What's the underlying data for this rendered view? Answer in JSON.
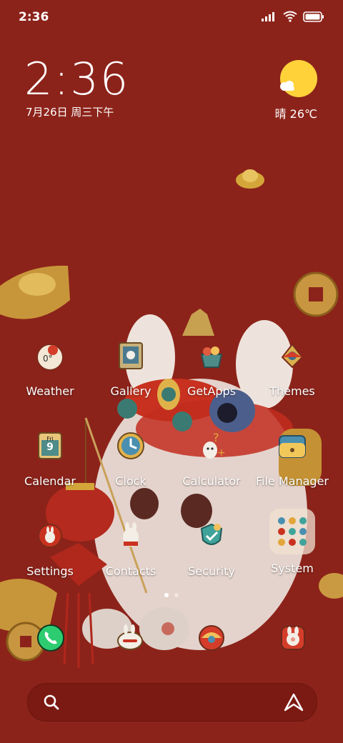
{
  "status_bar": {
    "time": "2:36"
  },
  "clock_widget": {
    "time": "2:36",
    "date": "7月26日 周三下午"
  },
  "weather_widget": {
    "condition_temp": "晴 26℃"
  },
  "apps": [
    {
      "label": "Weather",
      "icon": "weather-icon"
    },
    {
      "label": "Gallery",
      "icon": "gallery-icon"
    },
    {
      "label": "GetApps",
      "icon": "getapps-icon"
    },
    {
      "label": "Themes",
      "icon": "themes-icon"
    },
    {
      "label": "Calendar",
      "icon": "calendar-icon",
      "badge_top": "Fri",
      "badge_num": "9"
    },
    {
      "label": "Clock",
      "icon": "clock-icon"
    },
    {
      "label": "Calculator",
      "icon": "calculator-icon"
    },
    {
      "label": "File Manager",
      "icon": "folder-icon"
    },
    {
      "label": "Settings",
      "icon": "settings-icon"
    },
    {
      "label": "Contacts",
      "icon": "contacts-icon"
    },
    {
      "label": "Security",
      "icon": "security-icon"
    },
    {
      "label": "System",
      "icon": "system-folder-icon"
    }
  ],
  "page_indicator": {
    "pages": 2,
    "active": 1
  },
  "dock": [
    "phone-icon",
    "messages-icon",
    "browser-icon",
    "camera-icon"
  ],
  "colors": {
    "background": "#8c231a",
    "gold": "#d4a63a",
    "sun": "#ffd23a",
    "phone_green": "#2ecc71"
  }
}
